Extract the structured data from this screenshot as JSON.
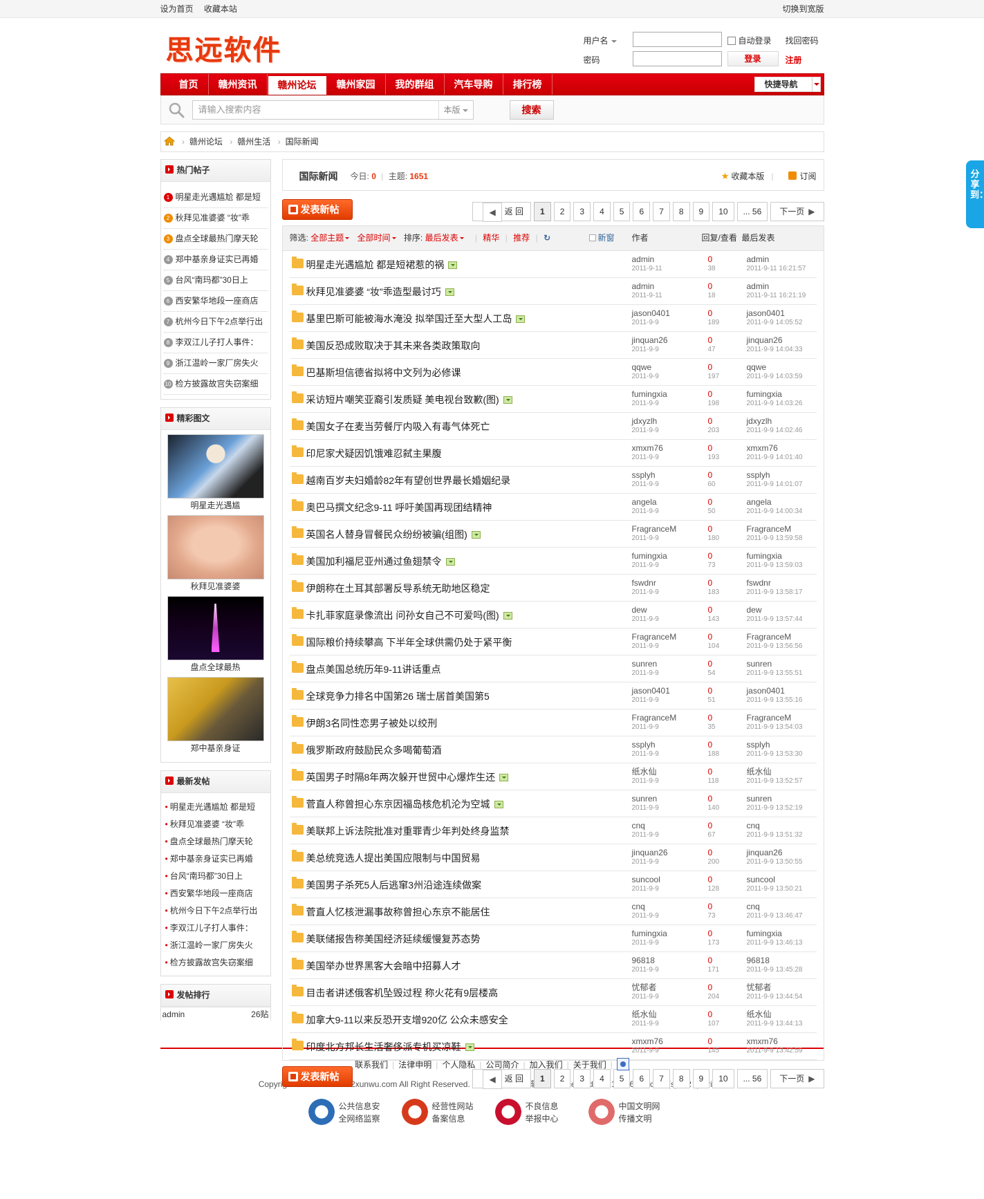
{
  "topbar": {
    "set_home": "设为首页",
    "bookmark": "收藏本站",
    "switch_wide": "切换到宽版"
  },
  "logo": "思远软件",
  "login": {
    "username_label": "用户名",
    "password_label": "密码",
    "auto_login": "自动登录",
    "forgot": "找回密码",
    "login_button": "登录",
    "register": "注册"
  },
  "nav": {
    "items": [
      "首页",
      "赣州资讯",
      "赣州论坛",
      "赣州家园",
      "我的群组",
      "汽车导购",
      "排行榜"
    ],
    "active_index": 2,
    "quick": "快捷导航"
  },
  "search": {
    "placeholder": "请输入搜索内容",
    "scope": "本版",
    "button": "搜索"
  },
  "breadcrumb": [
    "赣州论坛",
    "赣州生活",
    "国际新闻"
  ],
  "sidebar": {
    "hot_title": "热门帖子",
    "hot_items": [
      "明星走光遇尴尬 都是短",
      "秋拜见准婆婆 “妆”乖",
      "盘点全球最热门摩天轮",
      "郑中基亲身证实已再婚",
      "台风“南玛都”30日上",
      "西安繁华地段一座商店",
      "杭州今日下午2点举行出",
      "李双江儿子打人事件：",
      "浙江温岭一家厂房失火",
      "检方披露故宫失窃案细"
    ],
    "hot_nums": [
      "1",
      "2",
      "3",
      "4",
      "5",
      "6",
      "7",
      "8",
      "9",
      "10"
    ],
    "pics_title": "精彩图文",
    "pics": [
      "明星走光遇尴",
      "秋拜见准婆婆",
      "盘点全球最热",
      "郑中基亲身证"
    ],
    "new_title": "最新发帖",
    "new_items": [
      "明星走光遇尴尬 都是短",
      "秋拜见准婆婆 “妆”乖",
      "盘点全球最热门摩天轮",
      "郑中基亲身证实已再婚",
      "台风“南玛都”30日上",
      "西安繁华地段一座商店",
      "杭州今日下午2点举行出",
      "李双江儿子打人事件：",
      "浙江温岭一家厂房失火",
      "检方披露故宫失窃案细"
    ],
    "rank_title": "发帖排行",
    "rank": [
      {
        "name": "admin",
        "count": "26贴"
      }
    ]
  },
  "forum": {
    "title": "国际新闻",
    "today_label": "今日:",
    "today": "0",
    "topics_label": "主题:",
    "topics": "1651",
    "favorite": "收藏本版",
    "subscribe": "订阅",
    "new_post": "发表新帖"
  },
  "pager": {
    "back": "返 回",
    "pages": [
      "1",
      "2",
      "3",
      "4",
      "5",
      "6",
      "7",
      "8",
      "9",
      "10"
    ],
    "last": "... 56",
    "next": "下一页"
  },
  "table_header": {
    "filter_label": "筛选:",
    "all_topics": "全部主题",
    "all_time": "全部时间",
    "sort_label": "排序:",
    "last_post_sort": "最后发表",
    "digest": "精华",
    "recommend": "推荐",
    "new_window": "新窗",
    "author": "作者",
    "reply_view": "回复/查看",
    "last_post": "最后发表"
  },
  "threads": [
    {
      "title": "明星走光遇尴尬 都是短裙惹的祸",
      "img": true,
      "author": "admin",
      "date": "2011-9-11",
      "replies": "0",
      "views": "38",
      "last_user": "admin",
      "last_time": "2011-9-11 16:21:57"
    },
    {
      "title": "秋拜见准婆婆 “妆”乖造型最讨巧",
      "img": true,
      "author": "admin",
      "date": "2011-9-11",
      "replies": "0",
      "views": "18",
      "last_user": "admin",
      "last_time": "2011-9-11 16:21:19"
    },
    {
      "title": "基里巴斯可能被海水淹没 拟举国迁至大型人工岛",
      "img": true,
      "author": "jason0401",
      "date": "2011-9-9",
      "replies": "0",
      "views": "189",
      "last_user": "jason0401",
      "last_time": "2011-9-9 14:05:52"
    },
    {
      "title": "美国反恐成败取决于其未来各类政策取向",
      "img": false,
      "author": "jinquan26",
      "date": "2011-9-9",
      "replies": "0",
      "views": "47",
      "last_user": "jinquan26",
      "last_time": "2011-9-9 14:04:33"
    },
    {
      "title": "巴基斯坦信德省拟将中文列为必修课",
      "img": false,
      "author": "qqwe",
      "date": "2011-9-9",
      "replies": "0",
      "views": "197",
      "last_user": "qqwe",
      "last_time": "2011-9-9 14:03:59"
    },
    {
      "title": "采访短片嘲笑亚裔引发质疑 美电视台致歉(图)",
      "img": true,
      "author": "fumingxia",
      "date": "2011-9-9",
      "replies": "0",
      "views": "198",
      "last_user": "fumingxia",
      "last_time": "2011-9-9 14:03:26"
    },
    {
      "title": "美国女子在麦当劳餐厅内吸入有毒气体死亡",
      "img": false,
      "author": "jdxyzlh",
      "date": "2011-9-9",
      "replies": "0",
      "views": "203",
      "last_user": "jdxyzlh",
      "last_time": "2011-9-9 14:02:46"
    },
    {
      "title": "印尼家犬疑因饥饿难忍弑主果腹",
      "img": false,
      "author": "xmxm76",
      "date": "2011-9-9",
      "replies": "0",
      "views": "193",
      "last_user": "xmxm76",
      "last_time": "2011-9-9 14:01:40"
    },
    {
      "title": "越南百岁夫妇婚龄82年有望创世界最长婚姻纪录",
      "img": false,
      "author": "ssplyh",
      "date": "2011-9-9",
      "replies": "0",
      "views": "60",
      "last_user": "ssplyh",
      "last_time": "2011-9-9 14:01:07"
    },
    {
      "title": "奥巴马撰文纪念9-11 呼吁美国再现团结精神",
      "img": false,
      "author": "angela",
      "date": "2011-9-9",
      "replies": "0",
      "views": "50",
      "last_user": "angela",
      "last_time": "2011-9-9 14:00:34"
    },
    {
      "title": "英国名人替身冒餐民众纷纷被骗(组图)",
      "img": true,
      "author": "FragranceM",
      "date": "2011-9-9",
      "replies": "0",
      "views": "180",
      "last_user": "FragranceM",
      "last_time": "2011-9-9 13:59:58"
    },
    {
      "title": "美国加利福尼亚州通过鱼翅禁令",
      "img": true,
      "author": "fumingxia",
      "date": "2011-9-9",
      "replies": "0",
      "views": "73",
      "last_user": "fumingxia",
      "last_time": "2011-9-9 13:59:03"
    },
    {
      "title": "伊朗称在土耳其部署反导系统无助地区稳定",
      "img": false,
      "author": "fswdnr",
      "date": "2011-9-9",
      "replies": "0",
      "views": "183",
      "last_user": "fswdnr",
      "last_time": "2011-9-9 13:58:17"
    },
    {
      "title": "卡扎菲家庭录像流出 问孙女自己不可爱吗(图)",
      "img": true,
      "author": "dew",
      "date": "2011-9-9",
      "replies": "0",
      "views": "143",
      "last_user": "dew",
      "last_time": "2011-9-9 13:57:44"
    },
    {
      "title": "国际粮价持续攀高 下半年全球供需仍处于紧平衡",
      "img": false,
      "author": "FragranceM",
      "date": "2011-9-9",
      "replies": "0",
      "views": "104",
      "last_user": "FragranceM",
      "last_time": "2011-9-9 13:56:56"
    },
    {
      "title": "盘点美国总统历年9-11讲话重点",
      "img": false,
      "author": "sunren",
      "date": "2011-9-9",
      "replies": "0",
      "views": "54",
      "last_user": "sunren",
      "last_time": "2011-9-9 13:55:51"
    },
    {
      "title": "全球竞争力排名中国第26 瑞士居首美国第5",
      "img": false,
      "author": "jason0401",
      "date": "2011-9-9",
      "replies": "0",
      "views": "51",
      "last_user": "jason0401",
      "last_time": "2011-9-9 13:55:16"
    },
    {
      "title": "伊朗3名同性恋男子被处以绞刑",
      "img": false,
      "author": "FragranceM",
      "date": "2011-9-9",
      "replies": "0",
      "views": "35",
      "last_user": "FragranceM",
      "last_time": "2011-9-9 13:54:03"
    },
    {
      "title": "俄罗斯政府鼓励民众多喝葡萄酒",
      "img": false,
      "author": "ssplyh",
      "date": "2011-9-9",
      "replies": "0",
      "views": "188",
      "last_user": "ssplyh",
      "last_time": "2011-9-9 13:53:30"
    },
    {
      "title": "英国男子时隔8年两次躲开世贸中心爆炸生还",
      "img": true,
      "author": "纸水仙",
      "date": "2011-9-9",
      "replies": "0",
      "views": "118",
      "last_user": "纸水仙",
      "last_time": "2011-9-9 13:52:57"
    },
    {
      "title": "菅直人称曾担心东京因福岛核危机沦为空城",
      "img": true,
      "author": "sunren",
      "date": "2011-9-9",
      "replies": "0",
      "views": "140",
      "last_user": "sunren",
      "last_time": "2011-9-9 13:52:19"
    },
    {
      "title": "美联邦上诉法院批准对重罪青少年判处终身监禁",
      "img": false,
      "author": "cnq",
      "date": "2011-9-9",
      "replies": "0",
      "views": "67",
      "last_user": "cnq",
      "last_time": "2011-9-9 13:51:32"
    },
    {
      "title": "美总统竞选人提出美国应限制与中国贸易",
      "img": false,
      "author": "jinquan26",
      "date": "2011-9-9",
      "replies": "0",
      "views": "200",
      "last_user": "jinquan26",
      "last_time": "2011-9-9 13:50:55"
    },
    {
      "title": "美国男子杀死5人后逃窜3州沿途连续做案",
      "img": false,
      "author": "suncool",
      "date": "2011-9-9",
      "replies": "0",
      "views": "128",
      "last_user": "suncool",
      "last_time": "2011-9-9 13:50:21"
    },
    {
      "title": "菅直人忆核泄漏事故称曾担心东京不能居住",
      "img": false,
      "author": "cnq",
      "date": "2011-9-9",
      "replies": "0",
      "views": "73",
      "last_user": "cnq",
      "last_time": "2011-9-9 13:46:47"
    },
    {
      "title": "美联储报告称美国经济延续缓慢复苏态势",
      "img": false,
      "author": "fumingxia",
      "date": "2011-9-9",
      "replies": "0",
      "views": "173",
      "last_user": "fumingxia",
      "last_time": "2011-9-9 13:46:13"
    },
    {
      "title": "美国举办世界黑客大会暗中招募人才",
      "img": false,
      "author": "96818",
      "date": "2011-9-9",
      "replies": "0",
      "views": "171",
      "last_user": "96818",
      "last_time": "2011-9-9 13:45:28"
    },
    {
      "title": "目击者讲述俄客机坠毁过程 称火花有9层楼高",
      "img": false,
      "author": "忧郁者",
      "date": "2011-9-9",
      "replies": "0",
      "views": "204",
      "last_user": "忧郁者",
      "last_time": "2011-9-9 13:44:54"
    },
    {
      "title": "加拿大9-11以来反恐开支增920亿 公众未感安全",
      "img": false,
      "author": "纸水仙",
      "date": "2011-9-9",
      "replies": "0",
      "views": "107",
      "last_user": "纸水仙",
      "last_time": "2011-9-9 13:44:13"
    },
    {
      "title": "印度北方邦长生活奢侈派专机买凉鞋",
      "img": true,
      "author": "xmxm76",
      "date": "2011-9-9",
      "replies": "0",
      "views": "145",
      "last_user": "xmxm76",
      "last_time": "2011-9-9 13:42:59"
    }
  ],
  "footer": {
    "links": [
      "联系我们",
      "法律申明",
      "个人隐私",
      "公司简介",
      "加入我们",
      "关于我们"
    ],
    "copyright": "Copyright © 2010-2011 52xunwu.com All Right Reserved.  技术支持：思远软件  , Processed in 0.120661 second(s), 12 queries .",
    "badges": [
      {
        "line1": "公共信息安",
        "line2": "全网络监察",
        "color": "#2d6db6"
      },
      {
        "line1": "经营性网站",
        "line2": "备案信息",
        "color": "#d63a1a"
      },
      {
        "line1": "不良信息",
        "line2": "举报中心",
        "color": "#c8102e"
      },
      {
        "line1": "中国文明网",
        "line2": "传播文明",
        "color": "#e06a6a"
      }
    ]
  },
  "share": "分享到：",
  "colors": {
    "brand_red": "#d00000",
    "accent_orange": "#e8390e",
    "share_blue": "#1aa6e6"
  }
}
